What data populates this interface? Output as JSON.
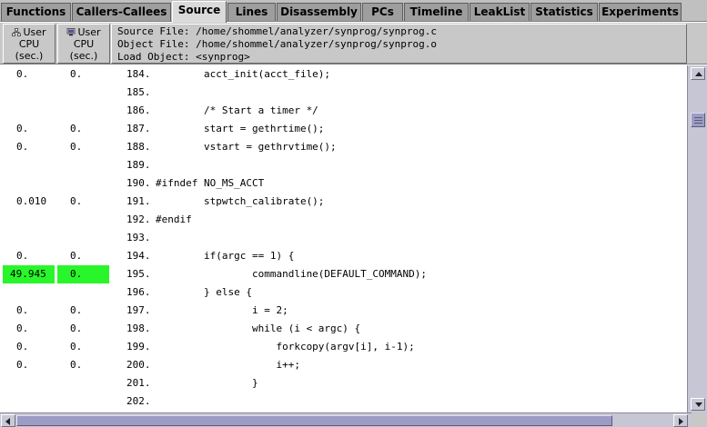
{
  "tabs": [
    {
      "label": "Functions"
    },
    {
      "label": "Callers-Callees"
    },
    {
      "label": "Source"
    },
    {
      "label": "Lines"
    },
    {
      "label": "Disassembly"
    },
    {
      "label": "PCs"
    },
    {
      "label": "Timeline"
    },
    {
      "label": "LeakList"
    },
    {
      "label": "Statistics"
    },
    {
      "label": "Experiments"
    }
  ],
  "active_tab": "Source",
  "columns": {
    "incl_user_cpu": {
      "line1": "User",
      "line2": "CPU",
      "line3": "(sec.)",
      "icon": "inclusive-metric-icon"
    },
    "excl_user_cpu": {
      "line1": "User",
      "line2": "CPU",
      "line3": "(sec.)",
      "icon": "exclusive-metric-icon"
    }
  },
  "source_info": {
    "source_file": "Source File: /home/shommel/analyzer/synprog/synprog.c",
    "object_file": "Object File: /home/shommel/analyzer/synprog/synprog.o",
    "load_object": "Load Object: <synprog>"
  },
  "rows": [
    {
      "m1": "0.",
      "m2": "0.",
      "line": "184.",
      "code": "        acct_init(acct_file);",
      "hot": false
    },
    {
      "m1": "",
      "m2": "",
      "line": "185.",
      "code": "",
      "hot": false
    },
    {
      "m1": "",
      "m2": "",
      "line": "186.",
      "code": "        /* Start a timer */",
      "hot": false
    },
    {
      "m1": "0.",
      "m2": "0.",
      "line": "187.",
      "code": "        start = gethrtime();",
      "hot": false
    },
    {
      "m1": "0.",
      "m2": "0.",
      "line": "188.",
      "code": "        vstart = gethrvtime();",
      "hot": false
    },
    {
      "m1": "",
      "m2": "",
      "line": "189.",
      "code": "",
      "hot": false
    },
    {
      "m1": "",
      "m2": "",
      "line": "190.",
      "code": "#ifndef NO_MS_ACCT",
      "hot": false
    },
    {
      "m1": "0.010",
      "m2": "0.",
      "line": "191.",
      "code": "        stpwtch_calibrate();",
      "hot": false
    },
    {
      "m1": "",
      "m2": "",
      "line": "192.",
      "code": "#endif",
      "hot": false
    },
    {
      "m1": "",
      "m2": "",
      "line": "193.",
      "code": "",
      "hot": false
    },
    {
      "m1": "0.",
      "m2": "0.",
      "line": "194.",
      "code": "        if(argc == 1) {",
      "hot": false
    },
    {
      "m1": "49.945",
      "m2": "0.",
      "line": "195.",
      "code": "                commandline(DEFAULT_COMMAND);",
      "hot": true
    },
    {
      "m1": "",
      "m2": "",
      "line": "196.",
      "code": "        } else {",
      "hot": false
    },
    {
      "m1": "0.",
      "m2": "0.",
      "line": "197.",
      "code": "                i = 2;",
      "hot": false
    },
    {
      "m1": "0.",
      "m2": "0.",
      "line": "198.",
      "code": "                while (i < argc) {",
      "hot": false
    },
    {
      "m1": "0.",
      "m2": "0.",
      "line": "199.",
      "code": "                    forkcopy(argv[i], i-1);",
      "hot": false
    },
    {
      "m1": "0.",
      "m2": "0.",
      "line": "200.",
      "code": "                    i++;",
      "hot": false
    },
    {
      "m1": "",
      "m2": "",
      "line": "201.",
      "code": "                }",
      "hot": false
    },
    {
      "m1": "",
      "m2": "",
      "line": "202.",
      "code": "",
      "hot": false
    }
  ],
  "colors": {
    "highlight": "#29f62a",
    "tab_bg": "#9e9e9e",
    "active_tab_bg": "#dadada",
    "scrollbar_thumb": "#9c9cc4"
  }
}
